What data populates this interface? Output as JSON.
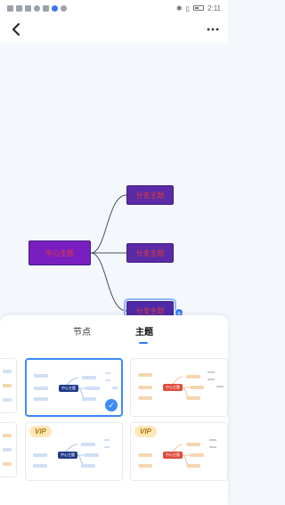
{
  "status": {
    "time": "2:11"
  },
  "header": {
    "back_icon": "chevron-left-icon",
    "more_icon": "more-horizontal-icon"
  },
  "canvas": {
    "central_topic": "中心主题",
    "branches": [
      {
        "label": "分支主题"
      },
      {
        "label": "分支主题"
      },
      {
        "label": "分支主题"
      }
    ],
    "colors": {
      "node_fill": "#5b2aa6",
      "node_text": "#e23b3b",
      "connector": "#4b4f5a",
      "add_button": "#2f7af5"
    }
  },
  "bottom_sheet": {
    "tabs": [
      {
        "label": "节点",
        "active": false
      },
      {
        "label": "主题",
        "active": true
      }
    ],
    "themes": [
      {
        "name": "blue",
        "center_label": "中心主题",
        "selected": true,
        "vip": false,
        "accent": "#1f3a8a"
      },
      {
        "name": "orange-red",
        "center_label": "中心主题",
        "selected": false,
        "vip": false,
        "accent": "#e04b3b"
      },
      {
        "name": "blue-vip",
        "center_label": "中心主题",
        "selected": false,
        "vip": true,
        "vip_label": "VIP",
        "accent": "#1f3a8a"
      },
      {
        "name": "orange-vip",
        "center_label": "中心主题",
        "selected": false,
        "vip": true,
        "vip_label": "VIP",
        "accent": "#e04b3b"
      }
    ]
  }
}
